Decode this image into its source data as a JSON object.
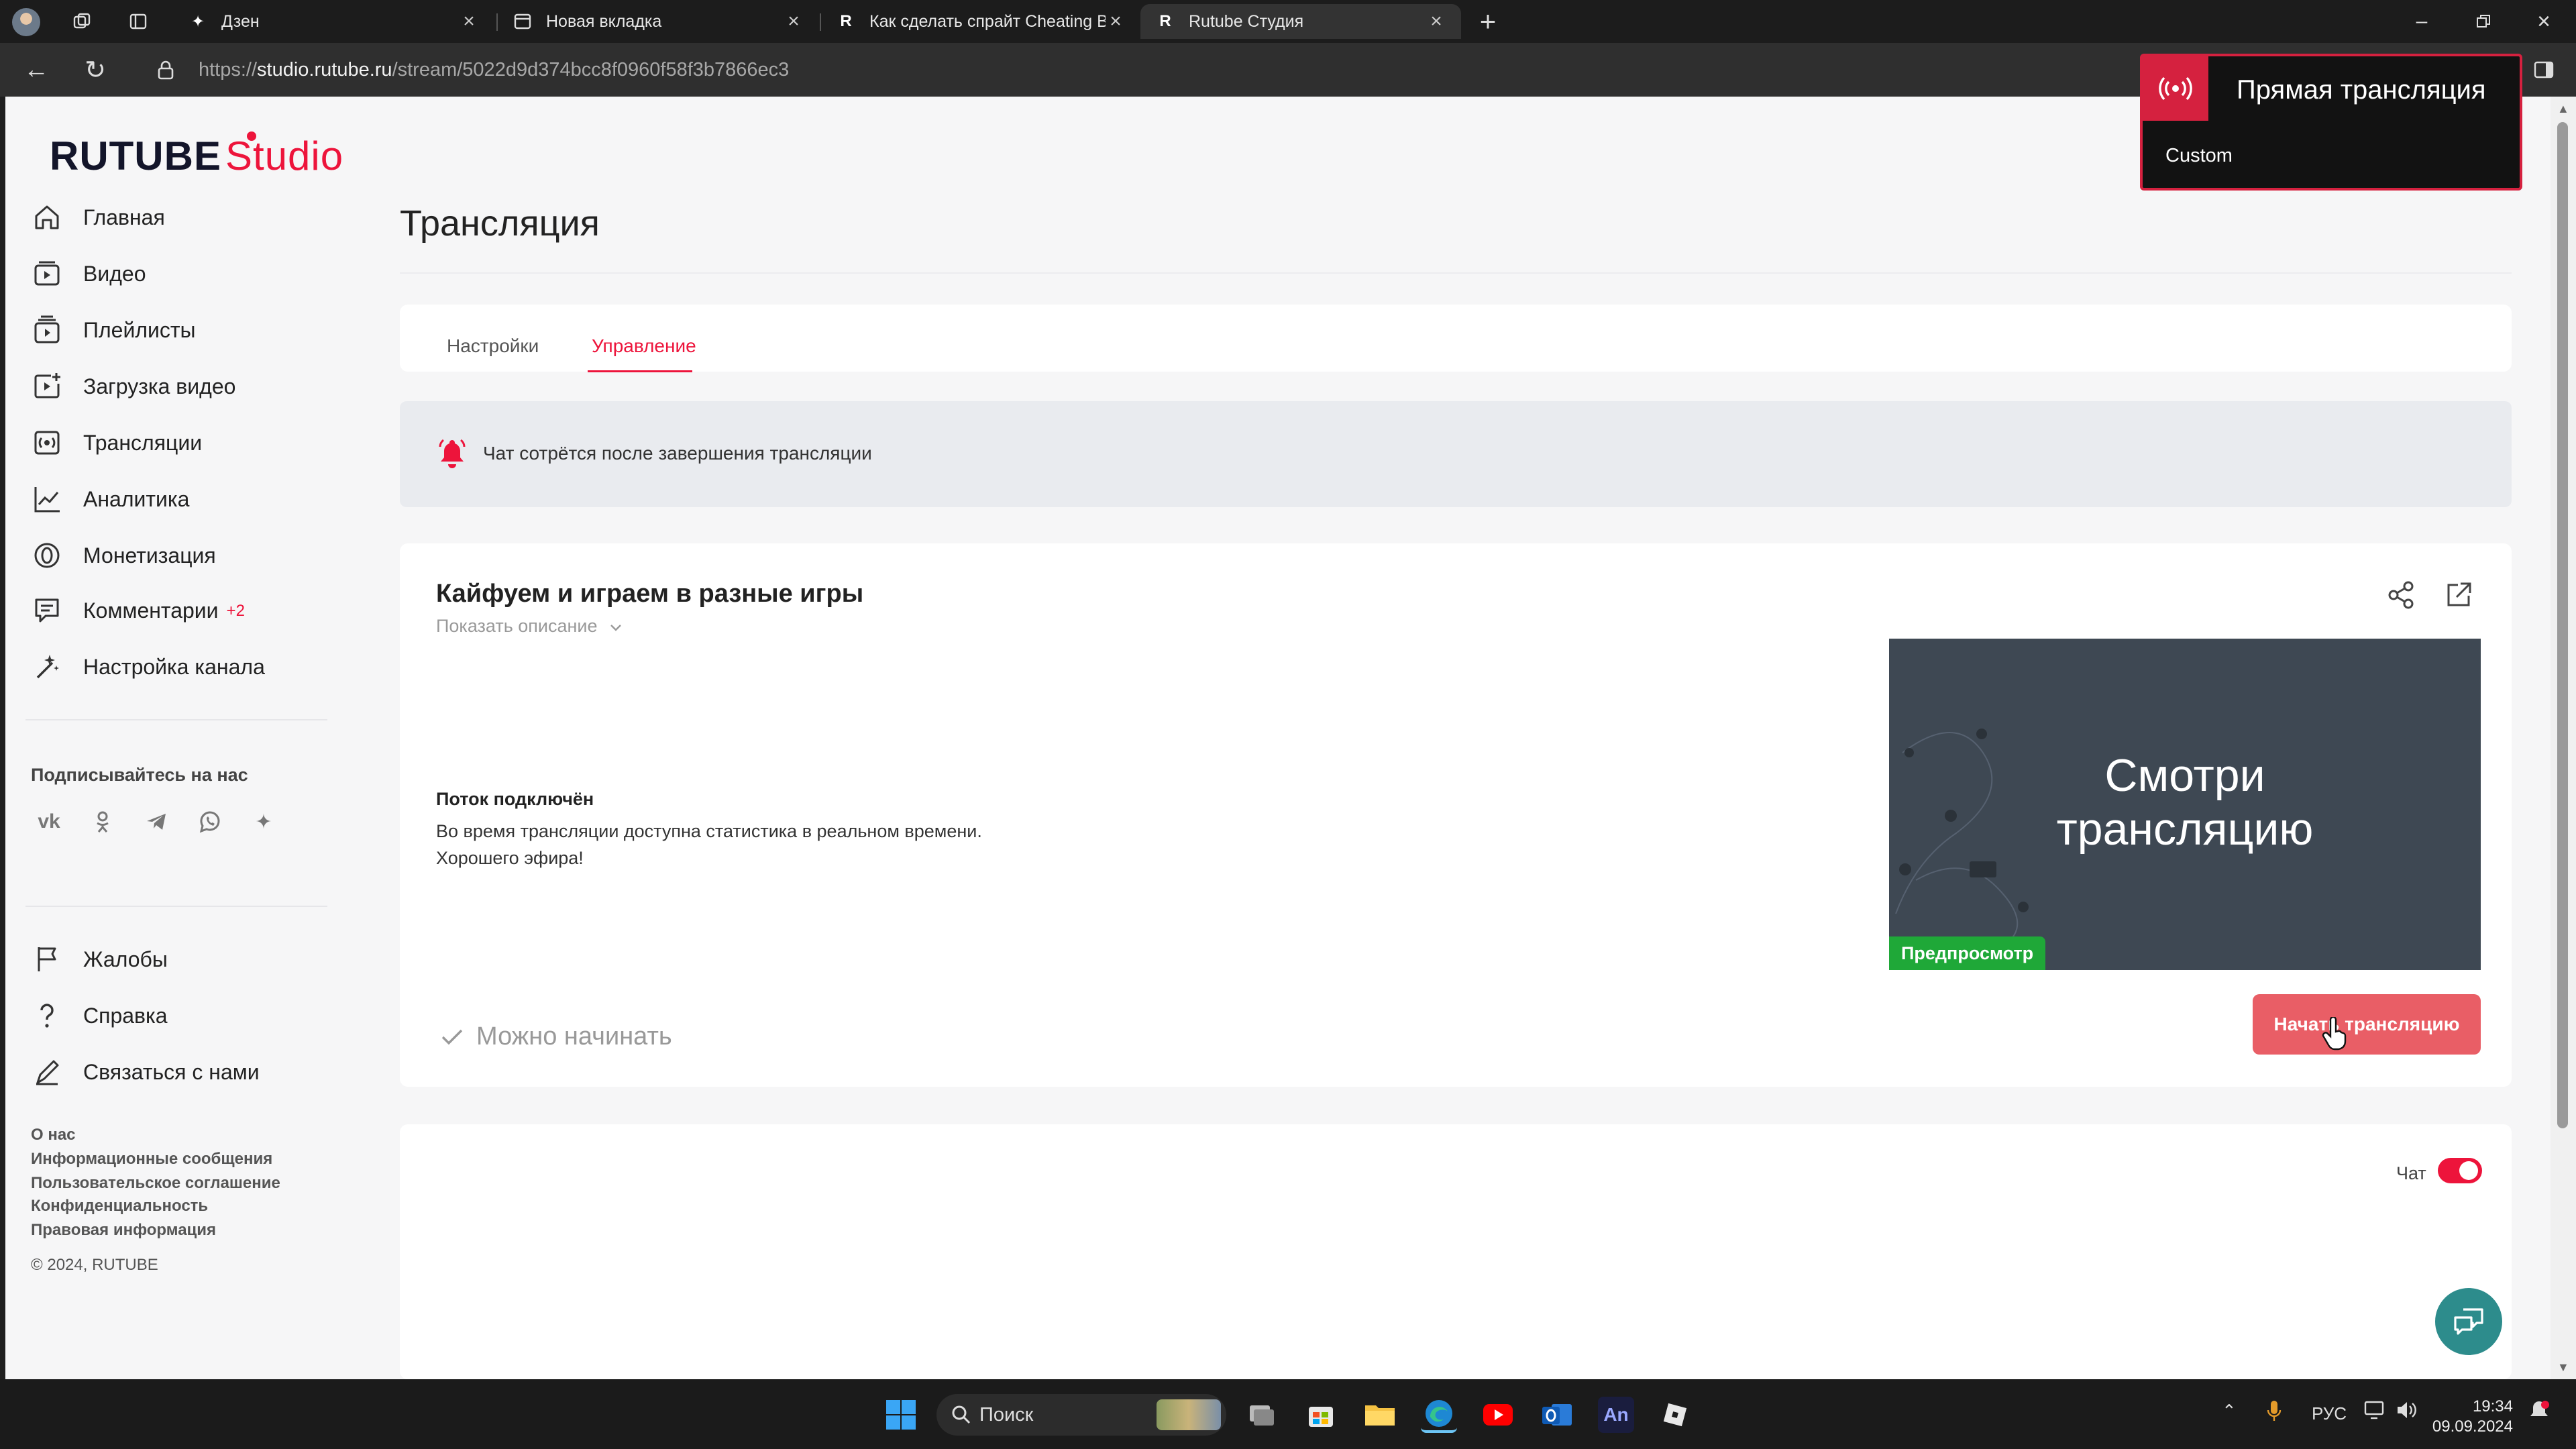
{
  "browser": {
    "tabs": [
      {
        "label": "Дзен"
      },
      {
        "label": "Новая вкладка"
      },
      {
        "label": "Как сделать спрайт Cheating Ba"
      },
      {
        "label": "Rutube Студия",
        "active": true
      }
    ],
    "url_prefix": "https://",
    "url_host": "studio.rutube.ru",
    "url_path": "/stream/5022d9d374bcc8f0960f58f3b7866ec3"
  },
  "logo": {
    "main": "RUTUBE",
    "studio": "Studio"
  },
  "sidebar": {
    "items": [
      {
        "label": "Главная",
        "icon": "home-icon"
      },
      {
        "label": "Видео",
        "icon": "video-icon"
      },
      {
        "label": "Плейлисты",
        "icon": "playlist-icon"
      },
      {
        "label": "Загрузка видео",
        "icon": "upload-icon"
      },
      {
        "label": "Трансляции",
        "icon": "broadcast-icon"
      },
      {
        "label": "Аналитика",
        "icon": "analytics-icon"
      },
      {
        "label": "Монетизация",
        "icon": "monetization-icon"
      },
      {
        "label": "Комментарии",
        "icon": "comments-icon",
        "badge": "+2"
      },
      {
        "label": "Настройка канала",
        "icon": "channel-settings-icon"
      }
    ],
    "subscribe_label": "Подписывайтесь на нас",
    "social": [
      "vk",
      "ok",
      "telegram",
      "viber",
      "zen"
    ],
    "bottom_items": [
      {
        "label": "Жалобы",
        "icon": "flag-icon"
      },
      {
        "label": "Справка",
        "icon": "help-icon"
      },
      {
        "label": "Связаться с нами",
        "icon": "contact-icon"
      }
    ],
    "footer_links": [
      "О нас",
      "Информационные сообщения",
      "Пользовательское соглашение",
      "Конфиденциальность",
      "Правовая информация"
    ],
    "copyright": "© 2024, RUTUBE"
  },
  "main": {
    "title": "Трансляция",
    "tabs": [
      {
        "label": "Настройки"
      },
      {
        "label": "Управление",
        "active": true
      }
    ],
    "alert_text": "Чат сотрётся после завершения трансляции",
    "stream": {
      "title": "Кайфуем и играем в разные игры",
      "show_description": "Показать описание",
      "status_heading": "Поток подключён",
      "status_line1": "Во время трансляции доступна статистика в реальном времени.",
      "status_line2": "Хорошего эфира!",
      "ready_label": "Можно начинать",
      "preview_line1": "Смотри",
      "preview_line2": "трансляцию",
      "preview_tag": "Предпросмотр",
      "start_button": "Начать трансляцию"
    },
    "chat": {
      "label": "Чат",
      "enabled": true
    }
  },
  "popup": {
    "title": "Прямая трансляция",
    "subtitle": "Custom"
  },
  "taskbar": {
    "search_placeholder": "Поиск",
    "language": "РУС",
    "time": "19:34",
    "date": "09.09.2024"
  },
  "colors": {
    "brand": "#ed143b",
    "start_button": "#e95e66",
    "preview_tag": "#1fa838",
    "preview_bg": "#3e4853"
  }
}
